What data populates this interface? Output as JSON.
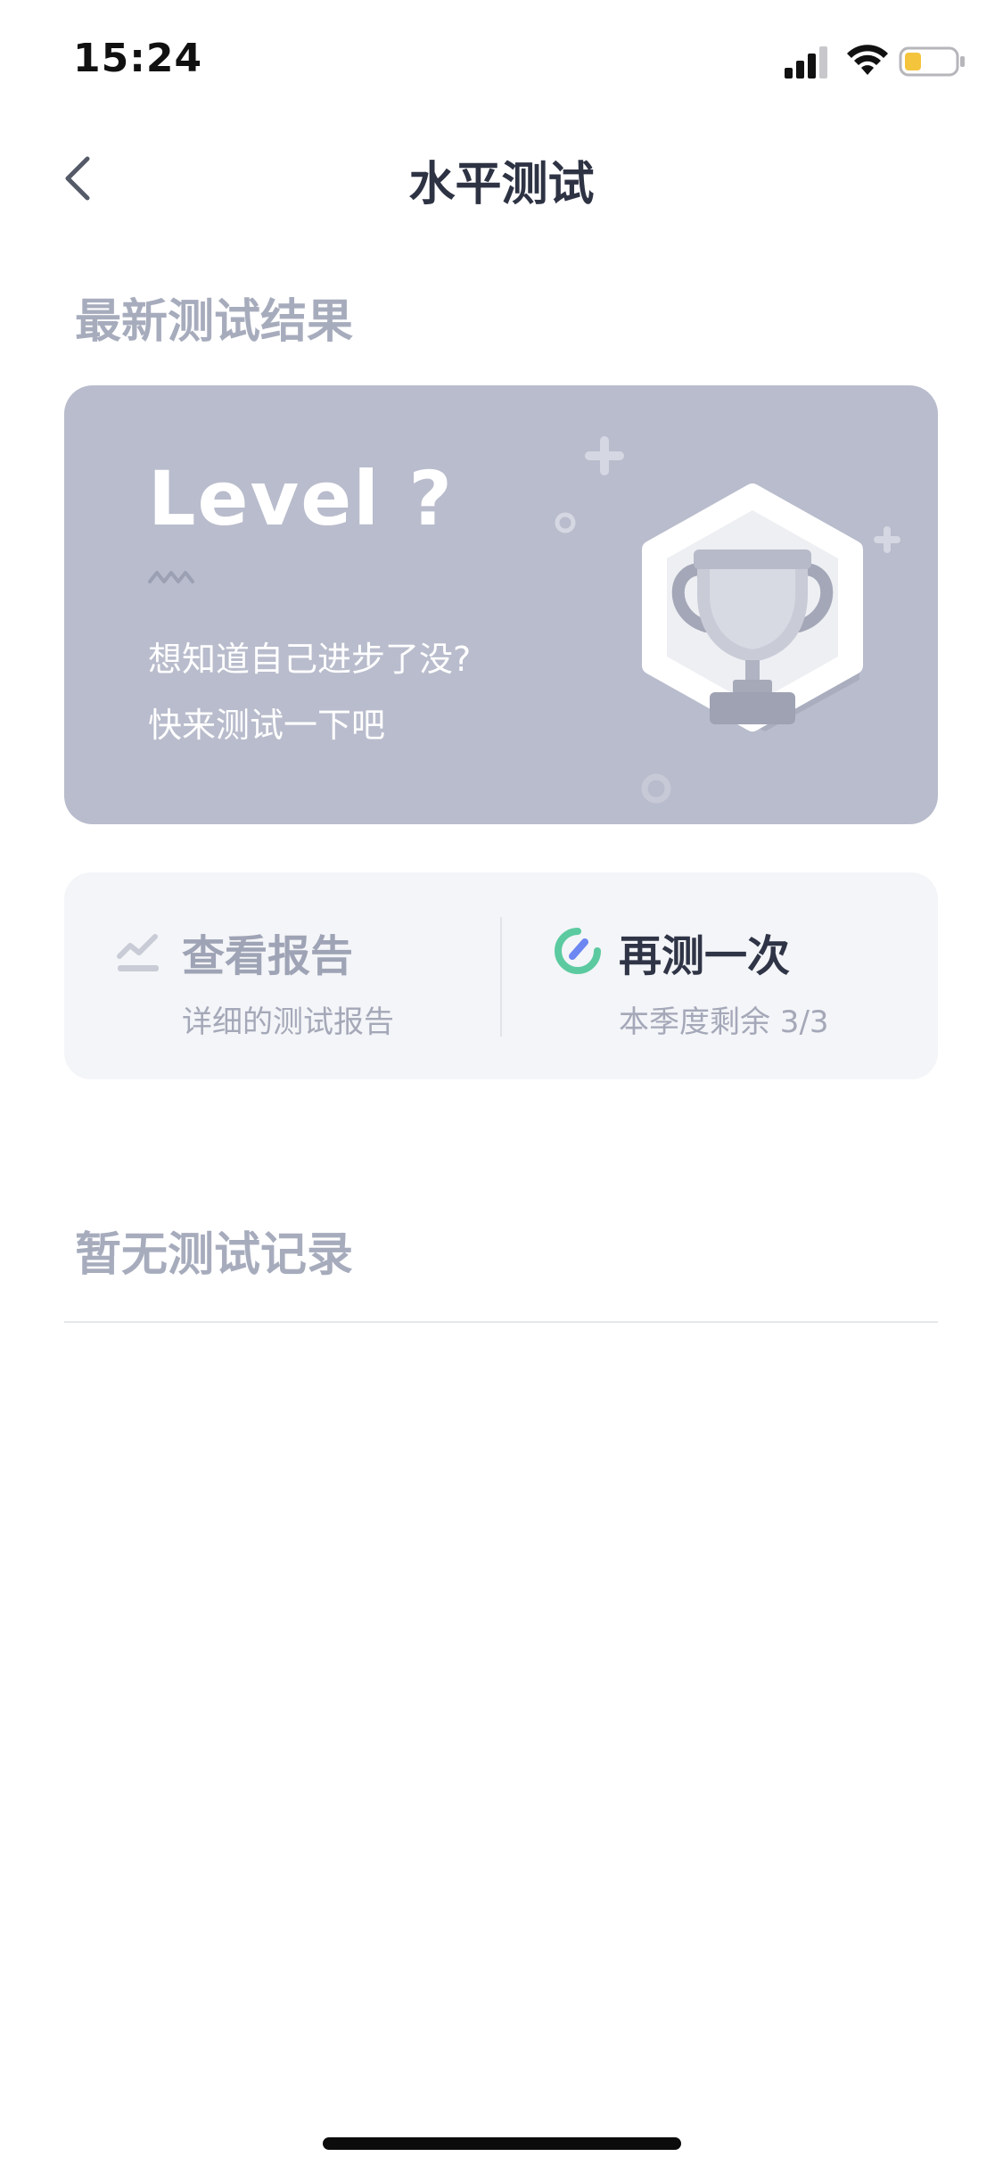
{
  "status_bar": {
    "time": "15:24",
    "icons": [
      "cellular-signal-icon",
      "wifi-icon",
      "battery-icon"
    ],
    "battery_color": "#f4c43c"
  },
  "nav": {
    "back_icon": "chevron-left-icon",
    "title": "水平测试"
  },
  "latest": {
    "section_title": "最新测试结果",
    "card": {
      "level": "Level ?",
      "desc_line1": "想知道自己进步了没?",
      "desc_line2": "快来测试一下吧",
      "icon": "trophy-icon",
      "background": "#b8bccc"
    }
  },
  "actions": {
    "report": {
      "icon": "chart-line-icon",
      "label": "查看报告",
      "subtitle": "详细的测试报告"
    },
    "retest": {
      "icon": "retest-progress-icon",
      "label": "再测一次",
      "subtitle": "本季度剩余 3/3"
    }
  },
  "history": {
    "empty_text": "暂无测试记录"
  },
  "colors": {
    "accent_green": "#5ccaa0",
    "accent_blue": "#6c86f2"
  }
}
